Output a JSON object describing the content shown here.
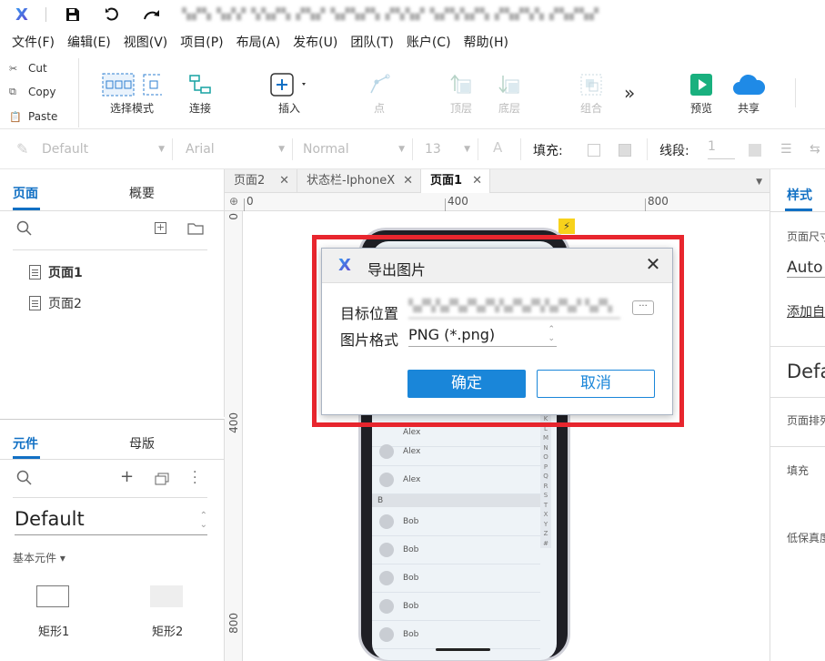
{
  "titlebar": {
    "title": "▚▞▚ ▚▞▞ ▚▚▞▚ ▞▚▞ ▚▞▚▞▚ ▞▚▚▞ ▚▞▚▚▞▚ ▞▚▞▚▚ ▞▚▞▚▞"
  },
  "menu": [
    "文件(F)",
    "编辑(E)",
    "视图(V)",
    "项目(P)",
    "布局(A)",
    "发布(U)",
    "团队(T)",
    "账户(C)",
    "帮助(H)"
  ],
  "clipboard": {
    "cut": "Cut",
    "copy": "Copy",
    "paste": "Paste"
  },
  "toolbar": {
    "select_mode": "选择模式",
    "connect": "连接",
    "insert": "插入",
    "point": "点",
    "top_layer": "顶层",
    "bottom_layer": "底层",
    "group": "组合",
    "more": "»",
    "preview": "预览",
    "share": "共享"
  },
  "formatbar": {
    "style": "Default",
    "font": "Arial",
    "weight": "Normal",
    "size": "13",
    "fill_label": "填充:",
    "stroke_label": "线段:",
    "stroke_value": "1"
  },
  "left_panel": {
    "tab_pages": "页面",
    "tab_outline": "概要",
    "pages": [
      "页面1",
      "页面2"
    ],
    "tab_widgets": "元件",
    "tab_masters": "母版",
    "library": "Default",
    "category": "基本元件 ▾",
    "widgets": [
      "矩形1",
      "矩形2"
    ]
  },
  "doc_tabs": [
    "页面2",
    "状态栏-IphoneX",
    "页面1"
  ],
  "ruler": {
    "h": [
      "0",
      "400",
      "800"
    ],
    "v": [
      "0",
      "400",
      "800"
    ]
  },
  "phone": {
    "contacts_top": [
      "Alex",
      "Alex",
      "Alex"
    ],
    "section": "B",
    "contacts_b": [
      "Bob",
      "Bob",
      "Bob",
      "Bob",
      "Bob"
    ],
    "alpha": [
      "K",
      "L",
      "M",
      "N",
      "O",
      "P",
      "Q",
      "R",
      "S",
      "T",
      "X",
      "Y",
      "Z",
      "#"
    ]
  },
  "right_panel": {
    "tab": "样式",
    "page_size_label": "页面尺寸",
    "page_size": "Auto",
    "add_adaptive": "添加自",
    "default": "Defa",
    "page_arrange": "页面排列",
    "fill": "填充",
    "low_fidelity": "低保真度"
  },
  "dialog": {
    "title": "导出图片",
    "target_label": "目标位置",
    "target_value": "▚▞▚▚▞▚▞▚▞▚▚▞▚▞▚▚▞▚▞ ▚▞▚",
    "browse": "···",
    "format_label": "图片格式",
    "format_value": "PNG (*.png)",
    "ok": "确定",
    "cancel": "取消"
  }
}
